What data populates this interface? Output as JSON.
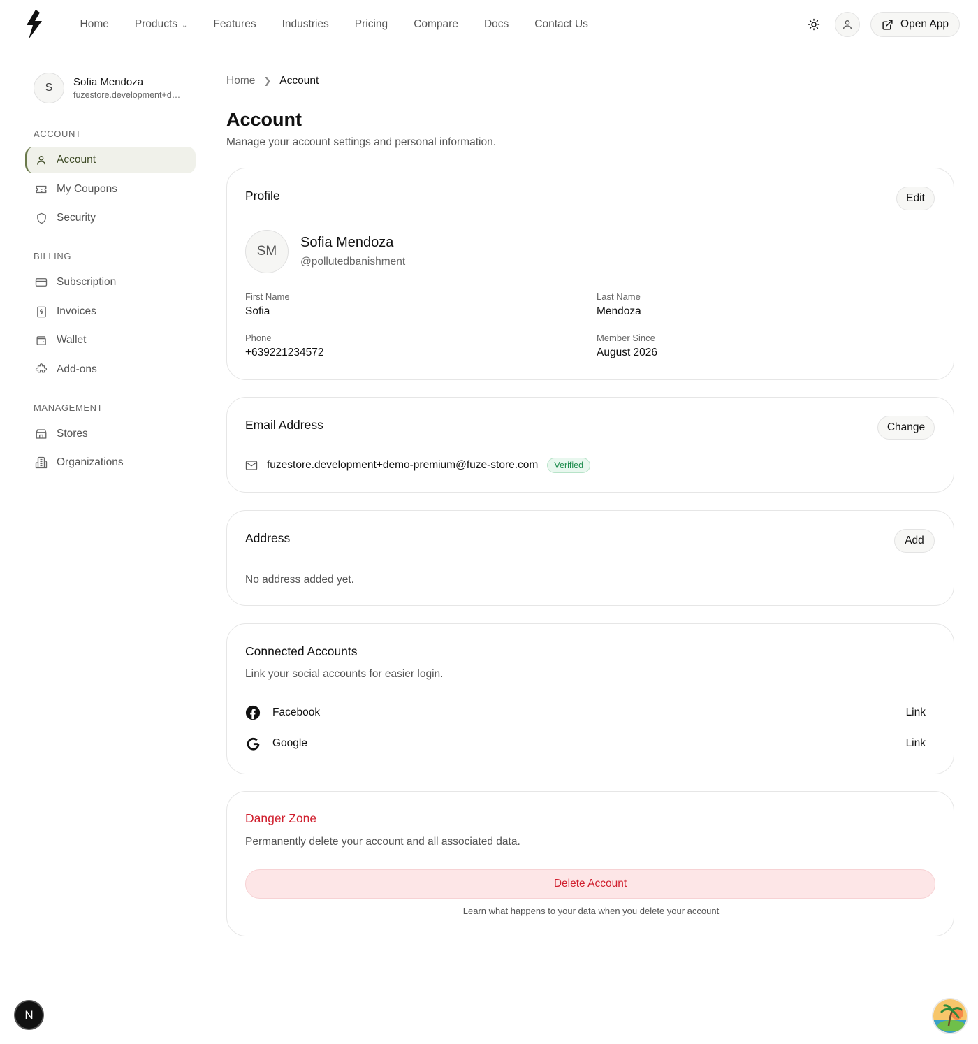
{
  "nav": {
    "links": [
      "Home",
      "Products",
      "Features",
      "Industries",
      "Pricing",
      "Compare",
      "Docs",
      "Contact Us"
    ],
    "open_app_label": "Open App"
  },
  "sidebar": {
    "user": {
      "initial": "S",
      "name": "Sofia Mendoza",
      "email": "fuzestore.development+demo-premium@fuze-store.com"
    },
    "sections": {
      "account": "ACCOUNT",
      "billing": "BILLING",
      "management": "MANAGEMENT"
    },
    "items": [
      {
        "label": "Account",
        "icon": "user-icon",
        "active": true
      },
      {
        "label": "My Coupons",
        "icon": "ticket-icon"
      },
      {
        "label": "Security",
        "icon": "shield-icon"
      },
      {
        "label": "Subscription",
        "icon": "credit-card-icon"
      },
      {
        "label": "Invoices",
        "icon": "receipt-icon"
      },
      {
        "label": "Wallet",
        "icon": "wallet-icon"
      },
      {
        "label": "Add-ons",
        "icon": "puzzle-icon"
      },
      {
        "label": "Stores",
        "icon": "store-icon"
      },
      {
        "label": "Organizations",
        "icon": "building-icon"
      }
    ]
  },
  "breadcrumb": {
    "home": "Home",
    "current": "Account"
  },
  "page": {
    "title": "Account",
    "subtitle": "Manage your account settings and personal information."
  },
  "profile": {
    "title": "Profile",
    "edit_label": "Edit",
    "initials": "SM",
    "full_name": "Sofia Mendoza",
    "handle": "@pollutedbanishment",
    "first_name_label": "First Name",
    "first_name": "Sofia",
    "last_name_label": "Last Name",
    "last_name": "Mendoza",
    "phone_label": "Phone",
    "phone": "+639221234572",
    "member_since_label": "Member Since",
    "member_since": "August 2026"
  },
  "email": {
    "title": "Email Address",
    "change_label": "Change",
    "address": "fuzestore.development+demo-premium@fuze-store.com",
    "verified_label": "Verified"
  },
  "address": {
    "title": "Address",
    "add_label": "Add",
    "empty_text": "No address added yet."
  },
  "connected": {
    "title": "Connected Accounts",
    "subtitle": "Link your social accounts for easier login.",
    "accounts": [
      {
        "name": "Facebook",
        "action": "Link"
      },
      {
        "name": "Google",
        "action": "Link"
      }
    ]
  },
  "danger": {
    "title": "Danger Zone",
    "subtitle": "Permanently delete your account and all associated data.",
    "delete_label": "Delete Account",
    "learn_link": "Learn what happens to your data when you delete your account"
  },
  "next_badge": "N",
  "colors": {
    "accent": "#6b7a4c",
    "danger": "#d01f2e",
    "verified": "#1a8a4a"
  }
}
